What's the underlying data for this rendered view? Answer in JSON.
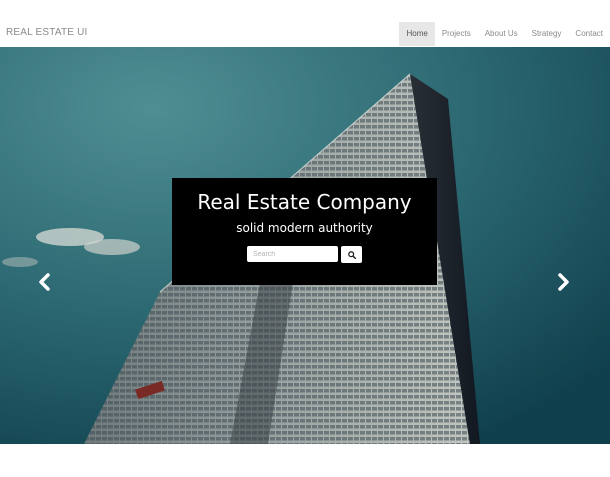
{
  "navbar": {
    "brand": "REAL ESTATE UI",
    "items": [
      {
        "label": "Home",
        "active": true
      },
      {
        "label": "Projects",
        "active": false
      },
      {
        "label": "About Us",
        "active": false
      },
      {
        "label": "Strategy",
        "active": false
      },
      {
        "label": "Contact",
        "active": false
      }
    ]
  },
  "hero": {
    "title": "Real Estate Company",
    "subtitle": "solid modern authority",
    "search": {
      "placeholder": "Search",
      "value": ""
    },
    "search_button_icon": "search-icon",
    "prev_icon": "chevron-left-icon",
    "next_icon": "chevron-right-icon",
    "slides_count": 3,
    "active_slide": 3
  },
  "colors": {
    "navbar_bg": "#ffffff",
    "nav_active_bg": "#e7e7e7",
    "nav_text": "#8a8a8a",
    "sky": "#2f6f77",
    "caption_bg": "#000000"
  }
}
